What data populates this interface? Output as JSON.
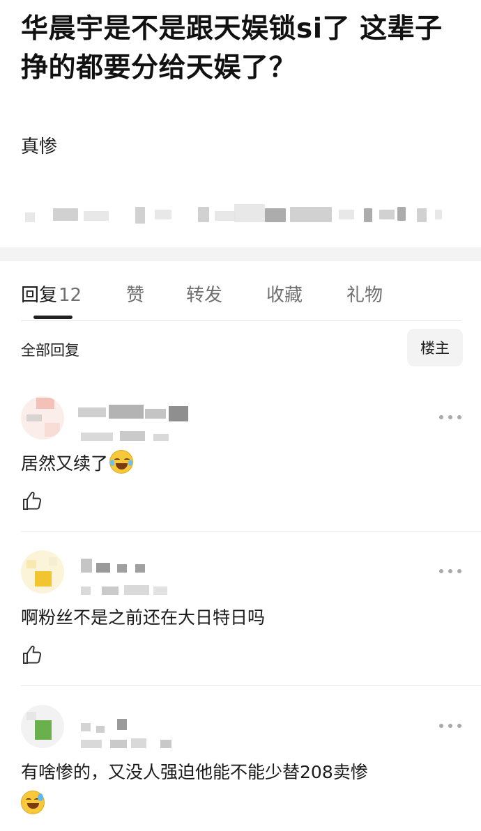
{
  "post": {
    "title": "华晨宇是不是跟天娱锁si了 这辈子挣的都要分给天娱了？",
    "body": "真惨"
  },
  "tabs": [
    {
      "label": "回复",
      "count": "12"
    },
    {
      "label": "赞"
    },
    {
      "label": "转发"
    },
    {
      "label": "收藏"
    },
    {
      "label": "礼物"
    }
  ],
  "filter": {
    "label": "全部回复",
    "author_only": "楼主"
  },
  "comments": [
    {
      "text": "居然又续了",
      "emoji": "laughing-tears-emoji"
    },
    {
      "text": "啊粉丝不是之前还在大日特日吗"
    },
    {
      "text": "有啥惨的，又没人强迫他能不能少替208卖惨",
      "emoji": "sweat-smile-emoji"
    }
  ],
  "icons": {
    "like": "thumbs-up-icon",
    "more": "more-dots-icon"
  },
  "colors": {
    "accent": "#222222",
    "muted": "#6f6f6f",
    "band": "#f3f3f3"
  }
}
